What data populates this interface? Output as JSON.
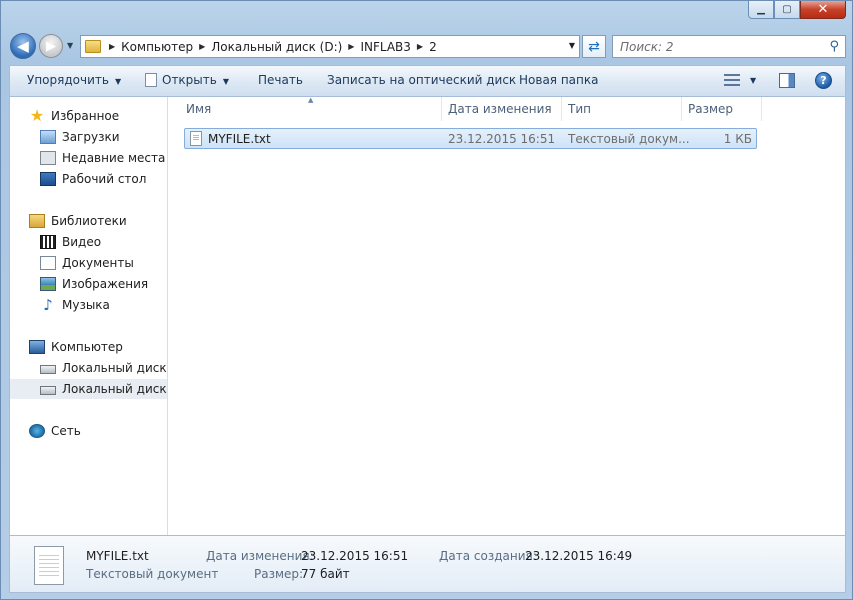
{
  "window": {
    "caption_buttons": [
      "minimize",
      "maximize",
      "close"
    ]
  },
  "navigation": {
    "breadcrumbs": [
      "Компьютер",
      "Локальный диск (D:)",
      "INFLAB3",
      "2"
    ],
    "search_placeholder": "Поиск: 2"
  },
  "toolbar": {
    "organize": "Упорядочить",
    "open": "Открыть",
    "print": "Печать",
    "burn": "Записать на оптический диск",
    "new_folder": "Новая папка"
  },
  "sidebar": {
    "favorites": {
      "title": "Избранное",
      "items": [
        "Загрузки",
        "Недавние места",
        "Рабочий стол"
      ]
    },
    "libraries": {
      "title": "Библиотеки",
      "items": [
        "Видео",
        "Документы",
        "Изображения",
        "Музыка"
      ]
    },
    "computer": {
      "title": "Компьютер",
      "items": [
        "Локальный диск (C",
        "Локальный диск (D"
      ],
      "selected_index": 1
    },
    "network": {
      "title": "Сеть"
    }
  },
  "file_list": {
    "columns": [
      "Имя",
      "Дата изменения",
      "Тип",
      "Размер"
    ],
    "sort_column": "Имя",
    "rows": [
      {
        "name": "MYFILE.txt",
        "modified": "23.12.2015 16:51",
        "type": "Текстовый докум...",
        "size": "1 КБ",
        "selected": true
      }
    ]
  },
  "details": {
    "filename": "MYFILE.txt",
    "filetype": "Текстовый документ",
    "modified_label": "Дата изменения:",
    "modified_value": "23.12.2015 16:51",
    "size_label": "Размер:",
    "size_value": "77 байт",
    "created_label": "Дата создания:",
    "created_value": "23.12.2015 16:49"
  },
  "colors": {
    "frame": "#bcd4ea",
    "selection": "#cde3f8",
    "close_button": "#c6422a"
  }
}
